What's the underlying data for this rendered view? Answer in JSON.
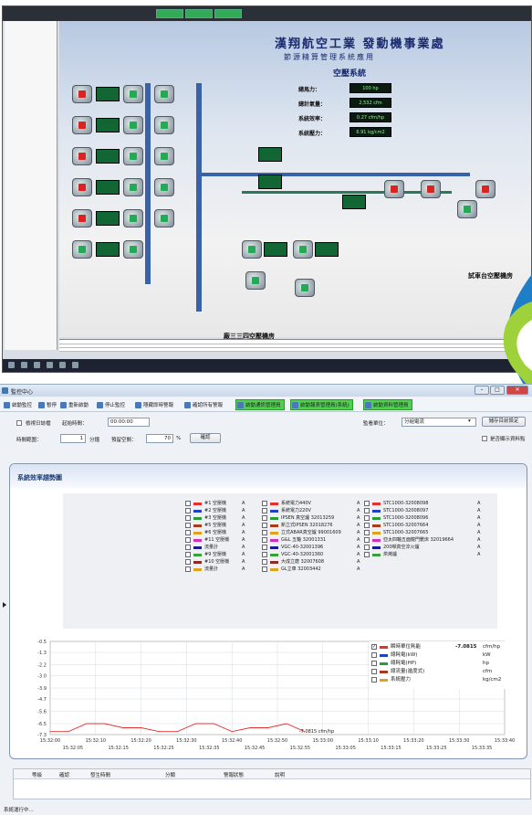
{
  "top_screen": {
    "scada_title": "漢翔航空工業 發動機事業處",
    "scada_subtitle": "節源精算管理系統應用",
    "scada_section": "空壓系統",
    "kpis": [
      {
        "label": "總馬力：",
        "value": "100 hp"
      },
      {
        "label": "總計氣量：",
        "value": "2,532 cfm"
      },
      {
        "label": "系統效率：",
        "value": "0.27 cfm/hp"
      },
      {
        "label": "系統壓力：",
        "value": "6.91 kg/cm2"
      }
    ],
    "footer_label": "廠三三四空壓機房",
    "right_label": "試車台空壓機房"
  },
  "app": {
    "title": "監控中心",
    "window_buttons": {
      "minimize": "–",
      "maximize": "□",
      "close": "✕"
    },
    "toolbar": [
      {
        "label": "啟動監控",
        "highlight": false
      },
      {
        "label": "暫停",
        "highlight": false
      },
      {
        "label": "重新啟動",
        "highlight": false
      },
      {
        "label": "停止監控",
        "highlight": false
      },
      {
        "label": "隱藏即時警報",
        "highlight": false
      },
      {
        "label": "確認所有警報",
        "highlight": false
      },
      {
        "label": "啟動通訊管理員",
        "highlight": true
      },
      {
        "label": "啟動報表管理員(系統)",
        "highlight": true
      },
      {
        "label": "啟動資料管理員",
        "highlight": true
      }
    ],
    "params": {
      "history_mode_label": "檢視日誌檔",
      "start_time_label": "起始時間：",
      "start_time_value": "00:00:00",
      "time_range_label": "時間範圍：",
      "time_range_value": "1",
      "time_range_unit": "分鐘",
      "preview_label": "預留空間：",
      "preview_value": "70",
      "preview_unit": "%",
      "confirm_button": "確認",
      "monitor_unit_label": "監看單位：",
      "monitor_unit_value": "分組電流",
      "save_settings_button": "儲存目前設定",
      "show_all_label": "是否顯示資料點"
    },
    "panel_title": "系統效率趨勢圖",
    "legend_columns": [
      [
        {
          "label": "#1 空壓機",
          "unit": "A",
          "color": "#e53030"
        },
        {
          "label": "#2 空壓機",
          "unit": "A",
          "color": "#2040c0"
        },
        {
          "label": "#3 空壓機",
          "unit": "A",
          "color": "#2a9a3a"
        },
        {
          "label": "#5 空壓機",
          "unit": "A",
          "color": "#a83a20"
        },
        {
          "label": "#6 空壓機",
          "unit": "A",
          "color": "#e0a020"
        },
        {
          "label": "#11 空壓機",
          "unit": "A",
          "color": "#d030c0"
        },
        {
          "label": "流量計",
          "unit": "A",
          "color": "#1a1a8a"
        },
        {
          "label": "#9 空壓機",
          "unit": "A",
          "color": "#3aa03a"
        },
        {
          "label": "#10 空壓機",
          "unit": "A",
          "color": "#8a2a2a"
        },
        {
          "label": "流量計",
          "unit": "A",
          "color": "#e0a020"
        }
      ],
      [
        {
          "label": "系統電力440V",
          "unit": "A",
          "color": "#e53030"
        },
        {
          "label": "系統電力220V",
          "unit": "A",
          "color": "#2040c0"
        },
        {
          "label": "IPSEN 真空爐 32013259",
          "unit": "A",
          "color": "#2a9a3a"
        },
        {
          "label": "新立式IPSEN 32018276",
          "unit": "A",
          "color": "#a83a20"
        },
        {
          "label": "立式ABAR真空爐 99001609",
          "unit": "A",
          "color": "#e0a020"
        },
        {
          "label": "G&L 五軸 32001331",
          "unit": "A",
          "color": "#d030c0"
        },
        {
          "label": "VGC-40-32001396",
          "unit": "A",
          "color": "#1a1a8a"
        },
        {
          "label": "VGC-40-32001360",
          "unit": "A",
          "color": "#3aa03a"
        },
        {
          "label": "大成立磨 32007608",
          "unit": "A",
          "color": "#8a2a2a"
        },
        {
          "label": "GL立車 32003442",
          "unit": "A",
          "color": "#e0a020"
        }
      ],
      [
        {
          "label": "STC1000-32008098",
          "unit": "A",
          "color": "#e53030"
        },
        {
          "label": "STC1000-32008097",
          "unit": "A",
          "color": "#2040c0"
        },
        {
          "label": "STC1000-32008096",
          "unit": "A",
          "color": "#2a9a3a"
        },
        {
          "label": "STC1000-32007664",
          "unit": "A",
          "color": "#a83a20"
        },
        {
          "label": "STC1000-32007665",
          "unit": "A",
          "color": "#e0a020"
        },
        {
          "label": "亞太四軸五面龍門銑床 32019664",
          "unit": "A",
          "color": "#d030c0"
        },
        {
          "label": "200噸真空淬火爐",
          "unit": "A",
          "color": "#1a1a8a"
        },
        {
          "label": "烘烤爐",
          "unit": "A",
          "color": "#3aa03a"
        }
      ]
    ],
    "value_rows": [
      {
        "label": "瞬時單位耗能",
        "value": "-7.0815",
        "unit": "cfm/hp",
        "color": "#e53030",
        "checked": true
      },
      {
        "label": "總耗電(kW)",
        "value": "",
        "unit": "kW",
        "color": "#2040c0",
        "checked": false
      },
      {
        "label": "總耗電(HP)",
        "value": "",
        "unit": "hp",
        "color": "#2a9a3a",
        "checked": false
      },
      {
        "label": "總流量(進度式)",
        "value": "",
        "unit": "cfm",
        "color": "#a83a20",
        "checked": false
      },
      {
        "label": "系統壓力",
        "value": "",
        "unit": "kg/cm2",
        "color": "#e0a020",
        "checked": false
      }
    ],
    "chart_data": {
      "type": "line",
      "title": "",
      "xlabel": "",
      "ylabel": "",
      "y_ticks": [
        "-0.5",
        "-1.3",
        "-2.2",
        "-3.0",
        "-3.9",
        "-4.7",
        "-5.6",
        "-6.5",
        "-7.3"
      ],
      "ylim": [
        -7.3,
        -0.5
      ],
      "x_ticks_top": [
        "15:32:00",
        "15:32:10",
        "15:32:20",
        "15:32:30",
        "15:32:40",
        "15:32:50",
        "15:33:00",
        "15:33:10",
        "15:33:20",
        "15:33:30",
        "15:33:40"
      ],
      "x_ticks_bottom": [
        "15:32:05",
        "15:32:15",
        "15:32:25",
        "15:32:35",
        "15:32:45",
        "15:32:55",
        "15:33:05",
        "15:33:15",
        "15:33:25",
        "15:33:35"
      ],
      "series": [
        {
          "name": "瞬時單位耗能",
          "color": "#e53030",
          "x_seconds": [
            0,
            4,
            8,
            12,
            16,
            20,
            24,
            28,
            32,
            36,
            40,
            44,
            48,
            52,
            56
          ],
          "values": [
            -7.08,
            -7.08,
            -6.5,
            -6.5,
            -6.8,
            -6.8,
            -7.08,
            -7.08,
            -6.5,
            -6.5,
            -7.08,
            -6.8,
            -6.8,
            -6.5,
            -7.08
          ]
        }
      ],
      "annotation": "-7.0815 cfm/hp"
    },
    "alarm_columns": [
      "等級",
      "確認",
      "發生時間",
      "分類",
      "警報狀態",
      "說明"
    ],
    "status_text": "系統運行中..."
  }
}
